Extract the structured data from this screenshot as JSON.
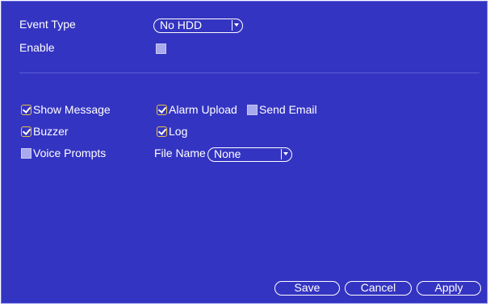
{
  "event_type": {
    "label": "Event Type",
    "value": "No HDD"
  },
  "enable": {
    "label": "Enable",
    "checked": false
  },
  "options": {
    "show_message": {
      "label": "Show Message",
      "checked": true
    },
    "alarm_upload": {
      "label": "Alarm Upload",
      "checked": true
    },
    "send_email": {
      "label": "Send Email",
      "checked": false
    },
    "buzzer": {
      "label": "Buzzer",
      "checked": true
    },
    "log": {
      "label": "Log",
      "checked": true
    },
    "voice_prompts": {
      "label": "Voice Prompts",
      "checked": false
    }
  },
  "file_name": {
    "label": "File Name",
    "value": "None"
  },
  "buttons": {
    "save": "Save",
    "cancel": "Cancel",
    "apply": "Apply"
  },
  "colors": {
    "background": "#3434c2",
    "check_border": "#e6c24a",
    "unchecked_fill": "#a9a9ee"
  }
}
